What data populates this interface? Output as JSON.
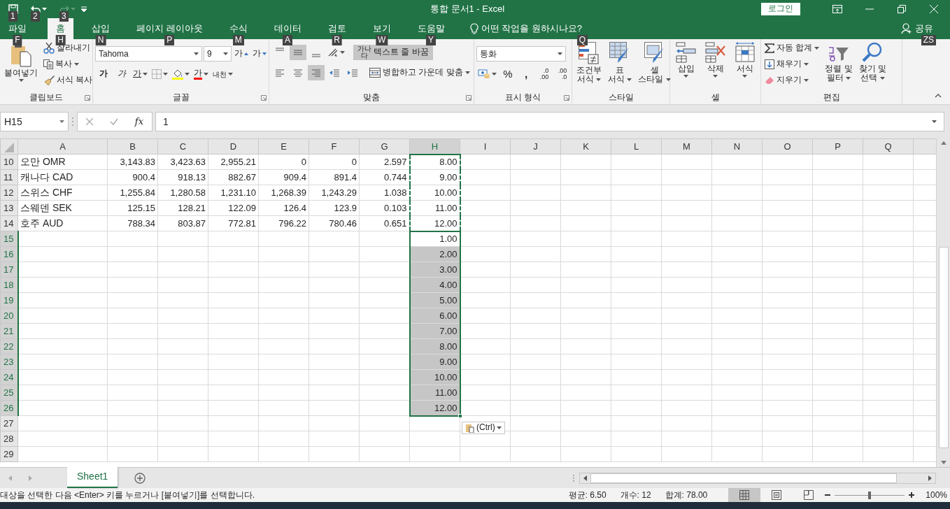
{
  "quick_access": {
    "keytips": [
      "1",
      "2",
      "3"
    ]
  },
  "window": {
    "title": "통합 문서1  -  Excel",
    "login_button": "로그인"
  },
  "tabs": [
    {
      "label": "파일",
      "keytip": "F",
      "selected": false
    },
    {
      "label": "홈",
      "keytip": "H",
      "selected": true
    },
    {
      "label": "삽입",
      "keytip": "N",
      "selected": false
    },
    {
      "label": "페이지 레이아웃",
      "keytip": "P",
      "selected": false
    },
    {
      "label": "수식",
      "keytip": "M",
      "selected": false
    },
    {
      "label": "데이터",
      "keytip": "A",
      "selected": false
    },
    {
      "label": "검토",
      "keytip": "R",
      "selected": false
    },
    {
      "label": "보기",
      "keytip": "W",
      "selected": false
    },
    {
      "label": "도움말",
      "keytip": "Y",
      "selected": false
    }
  ],
  "tell_me": {
    "text": "어떤 작업을 원하시나요?",
    "keytip": "Q"
  },
  "share": {
    "label": "공유",
    "keytip": "ZS"
  },
  "ribbon": {
    "clipboard": {
      "label": "클립보드",
      "paste": "붙여넣기",
      "cut": "잘라내기",
      "copy": "복사",
      "format_painter": "서식 복사"
    },
    "font": {
      "label": "글꼴",
      "font_name": "Tahoma",
      "font_size": "9",
      "grow": "가",
      "shrink": "가",
      "bold": "가",
      "italic": "가",
      "underline": "가",
      "font_color": "가",
      "phonetic": "내천"
    },
    "alignment": {
      "label": "맞춤",
      "vertical": [
        {
          "kind": "top",
          "selected": false
        },
        {
          "kind": "middle",
          "selected": true
        },
        {
          "kind": "bottom",
          "selected": false
        }
      ],
      "horizontal": [
        {
          "kind": "left",
          "selected": false
        },
        {
          "kind": "center",
          "selected": false
        },
        {
          "kind": "right",
          "selected": true
        }
      ],
      "wrap_text": {
        "label": "텍스트 줄 바꿈",
        "icon_text": [
          "가나",
          "다"
        ],
        "selected": true
      },
      "merge": "병합하고 가운데 맞춤"
    },
    "number": {
      "label": "표시 형식",
      "format": "통화",
      "percent": "%",
      "comma": ",",
      "increase_decimal": [
        ".0",
        ".00"
      ],
      "decrease_decimal": [
        ".00",
        ".0"
      ]
    },
    "styles": {
      "label": "스타일",
      "buttons": [
        {
          "kind": "conditional",
          "lines": [
            "조건부",
            "서식"
          ]
        },
        {
          "kind": "table",
          "lines": [
            "표",
            "서식"
          ]
        },
        {
          "kind": "cell",
          "lines": [
            "셀",
            "스타일"
          ]
        }
      ]
    },
    "cells": {
      "label": "셀",
      "buttons": [
        {
          "kind": "insert",
          "label": "삽입"
        },
        {
          "kind": "delete",
          "label": "삭제"
        },
        {
          "kind": "format",
          "label": "서식"
        }
      ]
    },
    "editing": {
      "label": "편집",
      "autosum": "자동 합계",
      "fill": "채우기",
      "clear": "지우기",
      "sort_filter": [
        "정렬 및",
        "필터"
      ],
      "find_select": [
        "찾기 및",
        "선택"
      ]
    }
  },
  "formula_bar": {
    "name_box": "H15",
    "function_label": "fx",
    "value": "1"
  },
  "columns": [
    {
      "letter": "A",
      "selected": false
    },
    {
      "letter": "B",
      "selected": false
    },
    {
      "letter": "C",
      "selected": false
    },
    {
      "letter": "D",
      "selected": false
    },
    {
      "letter": "E",
      "selected": false
    },
    {
      "letter": "F",
      "selected": false
    },
    {
      "letter": "G",
      "selected": false
    },
    {
      "letter": "H",
      "selected": true
    },
    {
      "letter": "I",
      "selected": false
    },
    {
      "letter": "J",
      "selected": false
    },
    {
      "letter": "K",
      "selected": false
    },
    {
      "letter": "L",
      "selected": false
    },
    {
      "letter": "M",
      "selected": false
    },
    {
      "letter": "N",
      "selected": false
    },
    {
      "letter": "O",
      "selected": false
    },
    {
      "letter": "P",
      "selected": false
    },
    {
      "letter": "Q",
      "selected": false
    }
  ],
  "rows": [
    {
      "number": "10",
      "selected": false,
      "copied": true,
      "cells": {
        "A": "오만 OMR",
        "B": "3,143.83",
        "C": "3,423.63",
        "D": "2,955.21",
        "E": "0",
        "F": "0",
        "G": "2.597",
        "H": "8.00"
      }
    },
    {
      "number": "11",
      "selected": false,
      "copied": true,
      "cells": {
        "A": "캐나다 CAD",
        "B": "900.4",
        "C": "918.13",
        "D": "882.67",
        "E": "909.4",
        "F": "891.4",
        "G": "0.744",
        "H": "9.00"
      }
    },
    {
      "number": "12",
      "selected": false,
      "copied": true,
      "cells": {
        "A": "스위스 CHF",
        "B": "1,255.84",
        "C": "1,280.58",
        "D": "1,231.10",
        "E": "1,268.39",
        "F": "1,243.29",
        "G": "1.038",
        "H": "10.00"
      }
    },
    {
      "number": "13",
      "selected": false,
      "copied": true,
      "cells": {
        "A": "스웨덴 SEK",
        "B": "125.15",
        "C": "128.21",
        "D": "122.09",
        "E": "126.4",
        "F": "123.9",
        "G": "0.103",
        "H": "11.00"
      }
    },
    {
      "number": "14",
      "selected": false,
      "copied": true,
      "cells": {
        "A": "호주 AUD",
        "B": "788.34",
        "C": "803.87",
        "D": "772.81",
        "E": "796.22",
        "F": "780.46",
        "G": "0.651",
        "H": "12.00"
      }
    },
    {
      "number": "15",
      "selected": true,
      "copied": false,
      "cells": {
        "H": "1.00"
      }
    },
    {
      "number": "16",
      "selected": true,
      "copied": false,
      "cells": {
        "H": "2.00"
      }
    },
    {
      "number": "17",
      "selected": true,
      "copied": false,
      "cells": {
        "H": "3.00"
      }
    },
    {
      "number": "18",
      "selected": true,
      "copied": false,
      "cells": {
        "H": "4.00"
      }
    },
    {
      "number": "19",
      "selected": true,
      "copied": false,
      "cells": {
        "H": "5.00"
      }
    },
    {
      "number": "20",
      "selected": true,
      "copied": false,
      "cells": {
        "H": "6.00"
      }
    },
    {
      "number": "21",
      "selected": true,
      "copied": false,
      "cells": {
        "H": "7.00"
      }
    },
    {
      "number": "22",
      "selected": true,
      "copied": false,
      "cells": {
        "H": "8.00"
      }
    },
    {
      "number": "23",
      "selected": true,
      "copied": false,
      "cells": {
        "H": "9.00"
      }
    },
    {
      "number": "24",
      "selected": true,
      "copied": false,
      "cells": {
        "H": "10.00"
      }
    },
    {
      "number": "25",
      "selected": true,
      "copied": false,
      "cells": {
        "H": "11.00"
      }
    },
    {
      "number": "26",
      "selected": true,
      "copied": false,
      "cells": {
        "H": "12.00"
      }
    },
    {
      "number": "27",
      "selected": false,
      "copied": false
    },
    {
      "number": "28",
      "selected": false,
      "copied": false
    },
    {
      "number": "29",
      "selected": false,
      "copied": false
    }
  ],
  "paste_options": "(Ctrl)",
  "sheet_tabs": [
    {
      "label": "Sheet1",
      "selected": true
    }
  ],
  "status_bar": {
    "message": "대상을 선택한 다음 <Enter> 키를 누르거나 [붙여넣기]를 선택합니다.",
    "stats": [
      "평균: 6.50",
      "개수: 12",
      "합계: 78.00"
    ],
    "views": [
      {
        "kind": "normal",
        "selected": true
      },
      {
        "kind": "page_layout",
        "selected": false
      },
      {
        "kind": "page_break",
        "selected": false
      }
    ],
    "zoom": {
      "level": 0.5,
      "label": "100%"
    }
  }
}
